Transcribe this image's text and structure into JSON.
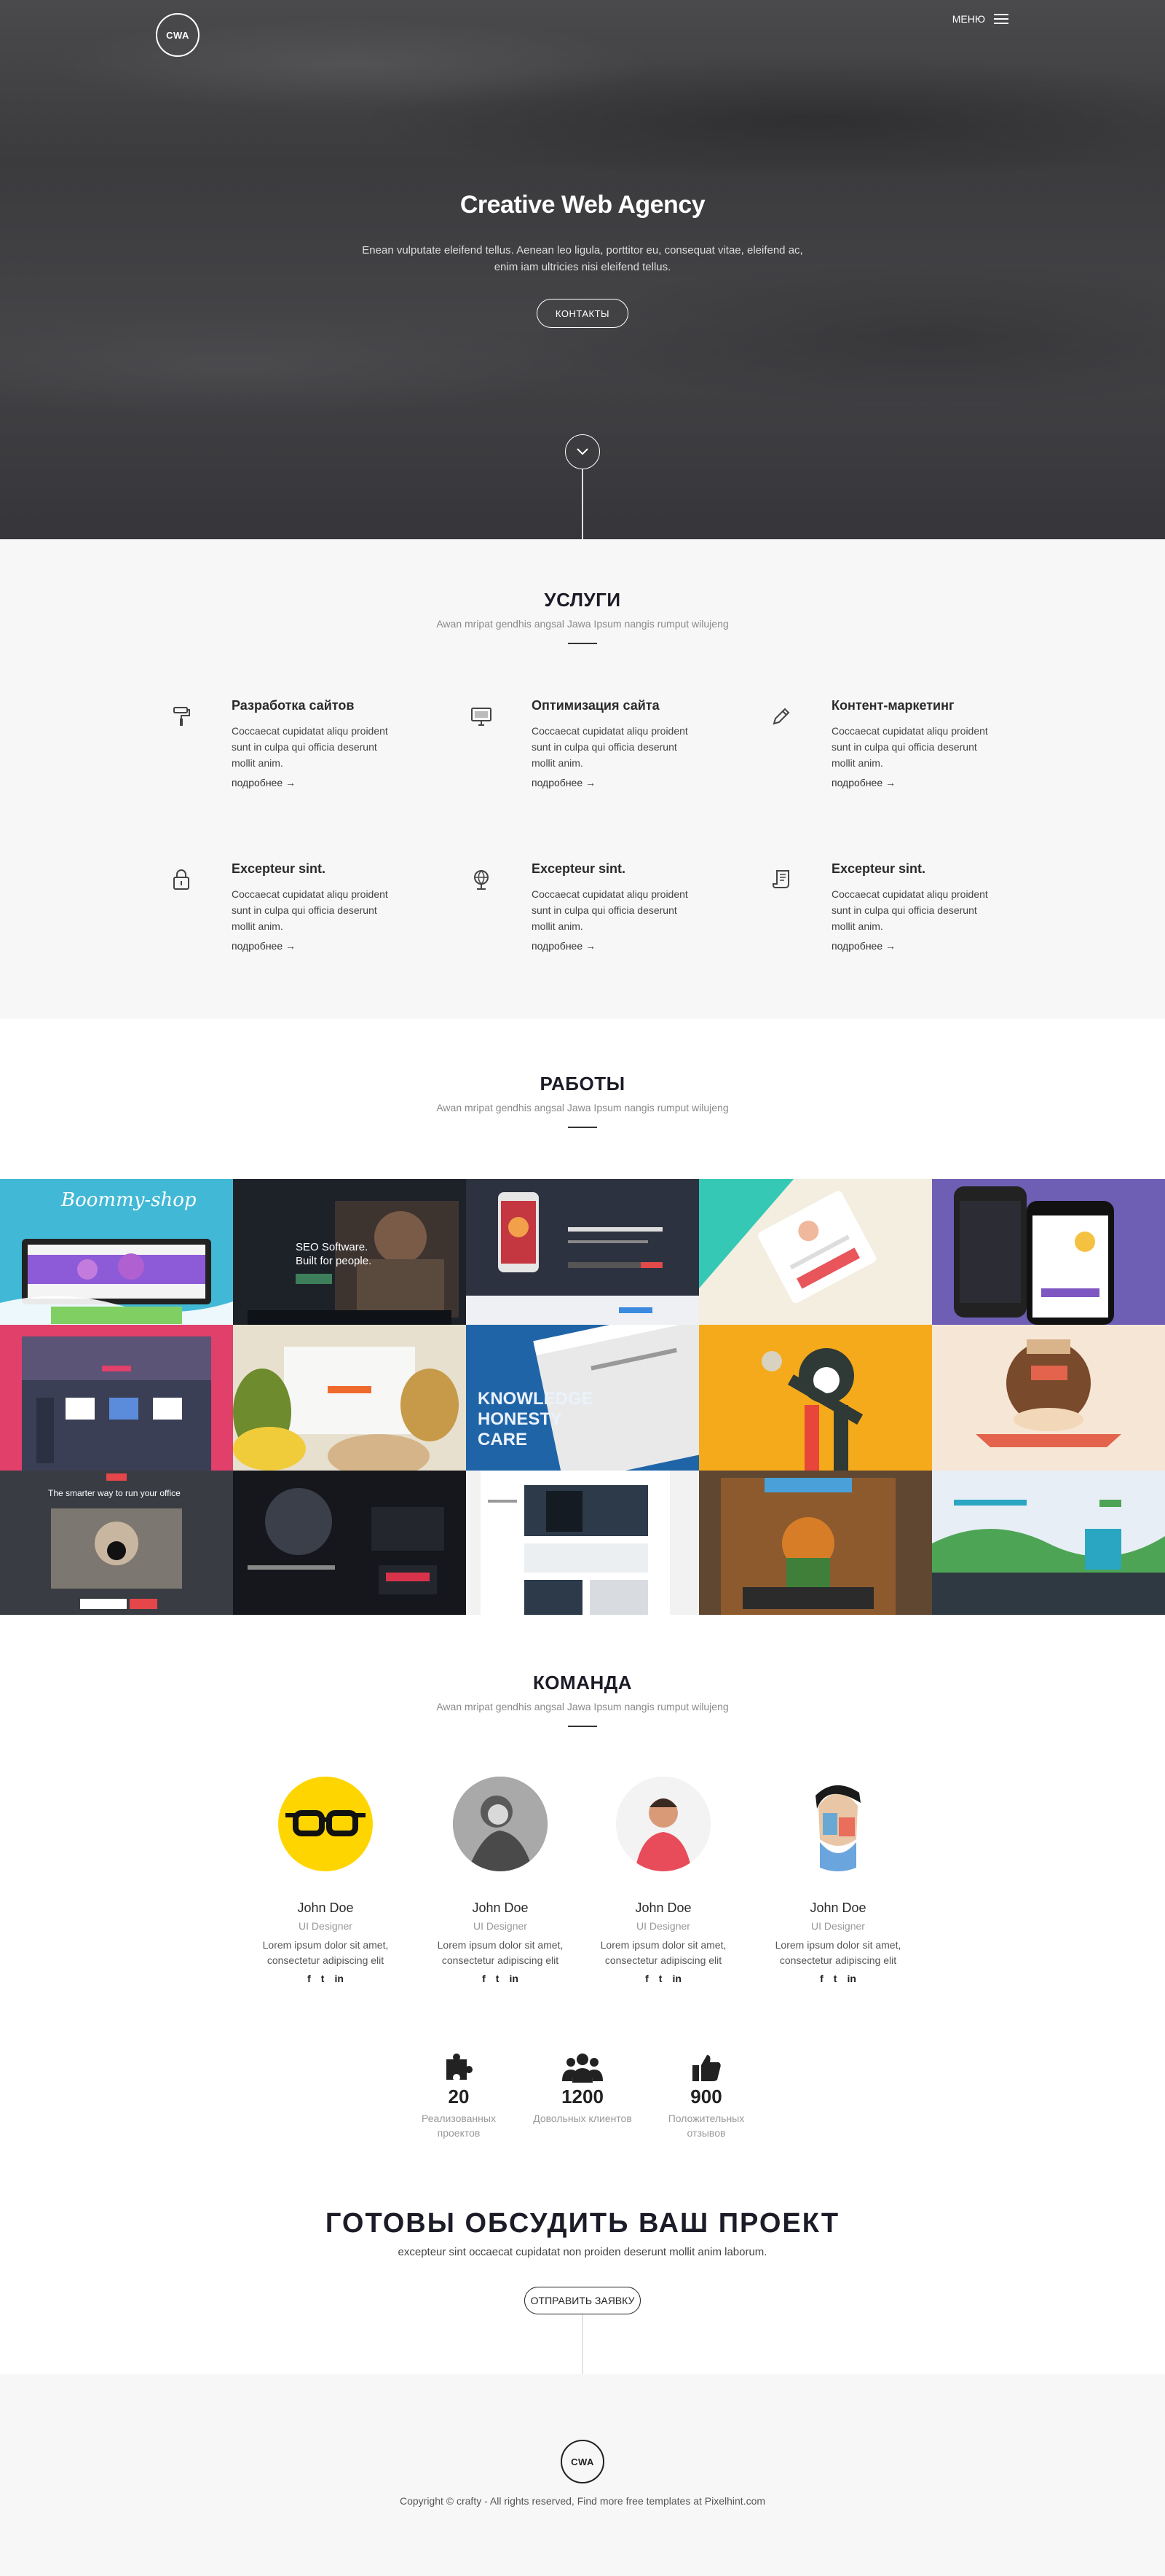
{
  "header": {
    "logo": "CWA",
    "menu_label": "МЕНЮ"
  },
  "hero": {
    "title": "Creative Web Agency",
    "text": "Enean vulputate eleifend tellus. Aenean leo ligula, porttitor eu, consequat vitae, eleifend ac, enim iam ultricies nisi eleifend tellus.",
    "button": "КОНТАКТЫ"
  },
  "services": {
    "title": "УСЛУГИ",
    "subtitle": "Awan mripat gendhis angsal Jawa Ipsum nangis rumput wilujeng",
    "items": [
      {
        "icon": "paint-roller-icon",
        "title": "Разработка сайтов",
        "text": "Coccaecat cupidatat aliqu proident sunt in culpa qui officia deserunt mollit anim.",
        "more": "подробнее →"
      },
      {
        "icon": "monitor-icon",
        "title": "Оптимизация сайта",
        "text": "Coccaecat cupidatat aliqu proident sunt in culpa qui officia deserunt mollit anim.",
        "more": "подробнее →"
      },
      {
        "icon": "pencil-icon",
        "title": "Контент-маркетинг",
        "text": "Coccaecat cupidatat aliqu proident sunt in culpa qui officia deserunt mollit anim.",
        "more": "подробнее →"
      },
      {
        "icon": "lock-icon",
        "title": "Excepteur sint.",
        "text": "Coccaecat cupidatat aliqu proident sunt in culpa qui officia deserunt mollit anim.",
        "more": "подробнее →"
      },
      {
        "icon": "globe-icon",
        "title": "Excepteur sint.",
        "text": "Coccaecat cupidatat aliqu proident sunt in culpa qui officia deserunt mollit anim.",
        "more": "подробнее →"
      },
      {
        "icon": "document-icon",
        "title": "Excepteur sint.",
        "text": "Coccaecat cupidatat aliqu proident sunt in culpa qui officia deserunt mollit anim.",
        "more": "подробнее →"
      }
    ]
  },
  "works": {
    "title": "РАБОТЫ",
    "subtitle": "Awan mripat gendhis angsal Jawa Ipsum nangis rumput wilujeng",
    "tiles": [
      {
        "caption": "Boommy-shop",
        "bg": "#41b8d6",
        "accent": "#8e5bd8"
      },
      {
        "caption": "SEO Software. Built for people.",
        "bg": "#1d2128",
        "accent": "#3c7f5a"
      },
      {
        "caption": "",
        "bg": "#2d3240",
        "accent": "#e6e6e6"
      },
      {
        "caption": "",
        "bg": "#f3eedf",
        "accent": "#35c8b5"
      },
      {
        "caption": "",
        "bg": "#6e5eb4",
        "accent": "#222"
      },
      {
        "caption": "",
        "bg": "#e0406a",
        "accent": "#3a3f55"
      },
      {
        "caption": "",
        "bg": "#e8e0cf",
        "accent": "#ef6a2d"
      },
      {
        "caption": "KNOWLEDGE HONESTY CARE",
        "bg": "#2064a8",
        "accent": "#e9e9e9"
      },
      {
        "caption": "",
        "bg": "#f5aa1c",
        "accent": "#2f3a36"
      },
      {
        "caption": "",
        "bg": "#f6e6d6",
        "accent": "#e3634c"
      },
      {
        "caption": "The smarter way to run your office",
        "bg": "#3a3c44",
        "accent": "#e5464a"
      },
      {
        "caption": "",
        "bg": "#15171c",
        "accent": "#d9334b"
      },
      {
        "caption": "",
        "bg": "#f2f2f2",
        "accent": "#2c3a4a"
      },
      {
        "caption": "",
        "bg": "#5f4731",
        "accent": "#d77d28"
      },
      {
        "caption": "",
        "bg": "#e7eef5",
        "accent": "#4ea455"
      }
    ]
  },
  "team": {
    "title": "КОМАНДА",
    "subtitle": "Awan mripat gendhis angsal Jawa Ipsum nangis rumput wilujeng",
    "members": [
      {
        "name": "John Doe",
        "role": "UI Designer",
        "text": "Lorem ipsum dolor sit amet, consectetur adipiscing elit",
        "avatar_bg": "#ffd500"
      },
      {
        "name": "John Doe",
        "role": "UI Designer",
        "text": "Lorem ipsum dolor sit amet, consectetur adipiscing elit",
        "avatar_bg": "#8b8b8b"
      },
      {
        "name": "John Doe",
        "role": "UI Designer",
        "text": "Lorem ipsum dolor sit amet, consectetur adipiscing elit",
        "avatar_bg": "#f1f1f1"
      },
      {
        "name": "John Doe",
        "role": "UI Designer",
        "text": "Lorem ipsum dolor sit amet, consectetur adipiscing elit",
        "avatar_bg": "#ffffff"
      }
    ],
    "social": [
      "f",
      "t",
      "in"
    ],
    "stats": [
      {
        "icon": "puzzle-icon",
        "number": "20",
        "label": "Реализованных проектов"
      },
      {
        "icon": "users-icon",
        "number": "1200",
        "label": "Довольных клиентов"
      },
      {
        "icon": "thumbs-up-icon",
        "number": "900",
        "label": "Положительных отзывов"
      }
    ]
  },
  "cta": {
    "title": "ГОТОВЫ ОБСУДИТЬ ВАШ ПРОЕКТ",
    "subtitle": "excepteur sint occaecat cupidatat non proiden deserunt mollit anim laborum.",
    "button": "ОТПРАВИТЬ ЗАЯВКУ"
  },
  "footer": {
    "logo": "CWA",
    "copyright": "Copyright © crafty - All rights reserved, Find more free templates at Pixelhint.com"
  }
}
